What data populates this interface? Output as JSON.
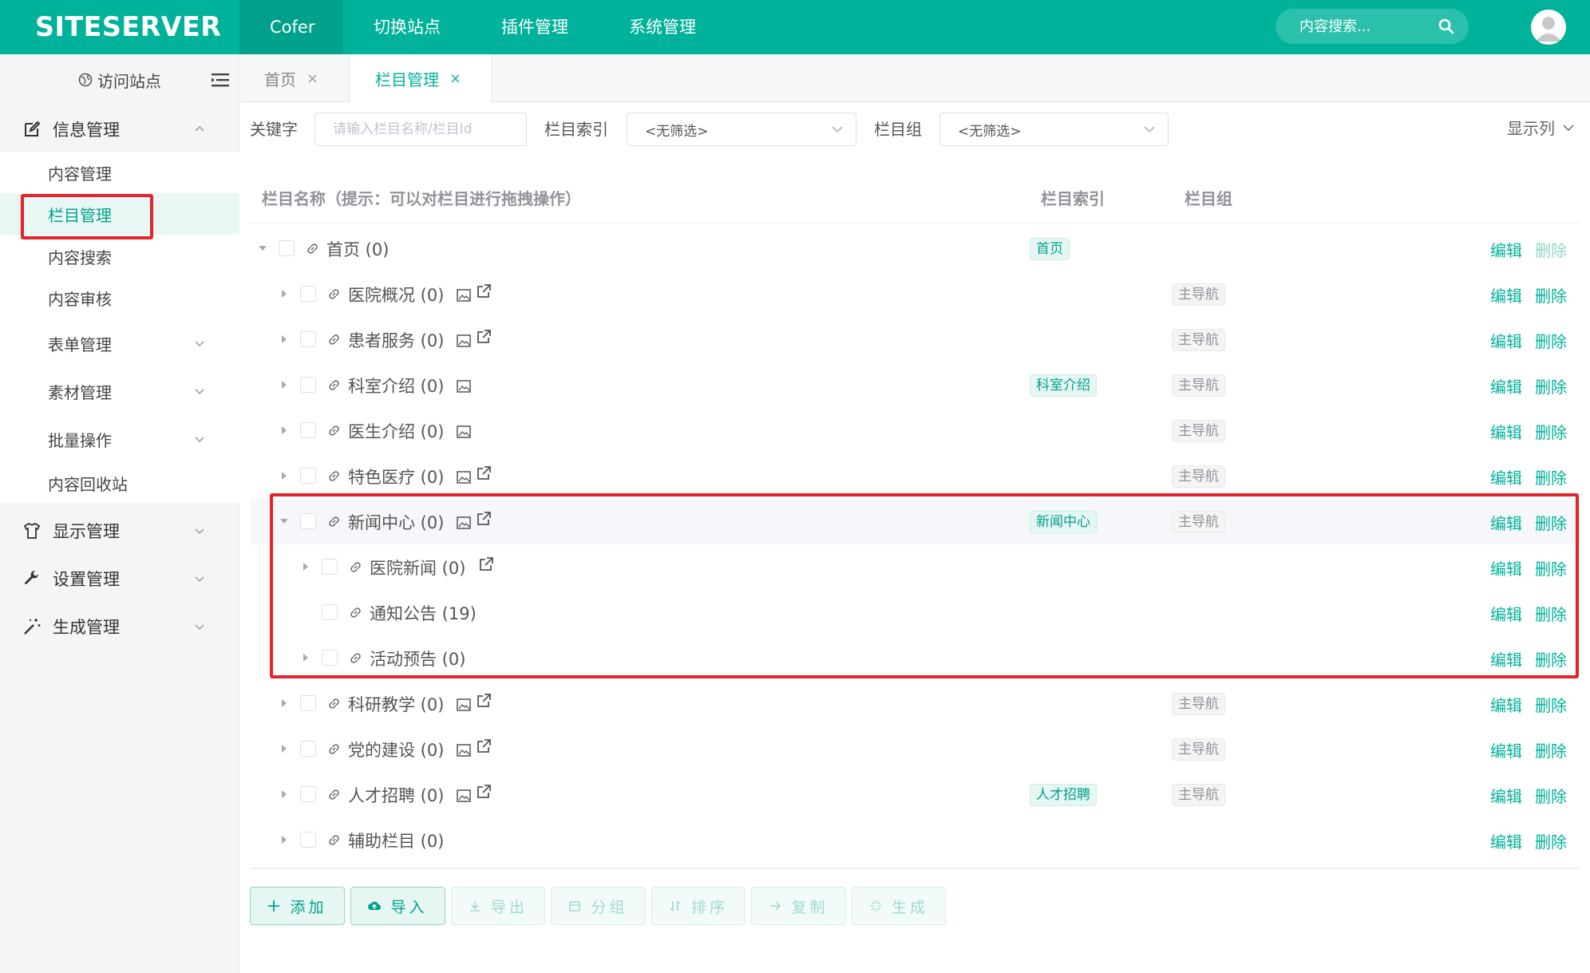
{
  "header": {
    "logo": "SITESERVER",
    "nav": [
      "Cofer",
      "切换站点",
      "插件管理",
      "系统管理"
    ],
    "search_placeholder": "内容搜索..."
  },
  "sidebar": {
    "visit_site": "访问站点",
    "groups": [
      {
        "label": "信息管理",
        "icon": "edit-icon",
        "expanded": true
      },
      {
        "label": "显示管理",
        "icon": "shirt-icon"
      },
      {
        "label": "设置管理",
        "icon": "wrench-icon"
      },
      {
        "label": "生成管理",
        "icon": "magic-wand-icon"
      }
    ],
    "sub_items": [
      "内容管理",
      "栏目管理",
      "内容搜索",
      "内容审核",
      "表单管理",
      "素材管理",
      "批量操作",
      "内容回收站"
    ],
    "active_sub": "栏目管理"
  },
  "tabs": [
    {
      "label": "首页"
    },
    {
      "label": "栏目管理",
      "active": true
    }
  ],
  "filters": {
    "keyword_label": "关键字",
    "keyword_placeholder": "请输入栏目名称/栏目Id",
    "index_label": "栏目索引",
    "index_value": "<无筛选>",
    "group_label": "栏目组",
    "group_value": "<无筛选>",
    "show_columns": "显示列"
  },
  "table": {
    "columns": {
      "name": "栏目名称（提示：可以对栏目进行拖拽操作）",
      "index": "栏目索引",
      "group": "栏目组"
    },
    "edit_label": "编辑",
    "delete_label": "删除",
    "rows": [
      {
        "name": "首页 (0)",
        "index": "首页",
        "group": ""
      },
      {
        "name": "医院概况 (0)",
        "index": "",
        "group": "主导航"
      },
      {
        "name": "患者服务 (0)",
        "index": "",
        "group": "主导航"
      },
      {
        "name": "科室介绍 (0)",
        "index": "科室介绍",
        "group": "主导航"
      },
      {
        "name": "医生介绍 (0)",
        "index": "",
        "group": "主导航"
      },
      {
        "name": "特色医疗 (0)",
        "index": "",
        "group": "主导航"
      },
      {
        "name": "新闻中心 (0)",
        "index": "新闻中心",
        "group": "主导航"
      },
      {
        "name": "医院新闻 (0)",
        "index": "",
        "group": ""
      },
      {
        "name": "通知公告 (19)",
        "index": "",
        "group": ""
      },
      {
        "name": "活动预告 (0)",
        "index": "",
        "group": ""
      },
      {
        "name": "科研教学 (0)",
        "index": "",
        "group": "主导航"
      },
      {
        "name": "党的建设 (0)",
        "index": "",
        "group": "主导航"
      },
      {
        "name": "人才招聘 (0)",
        "index": "人才招聘",
        "group": "主导航"
      },
      {
        "name": "辅助栏目 (0)",
        "index": "",
        "group": ""
      }
    ]
  },
  "actions": [
    "添加",
    "导入",
    "导出",
    "分组",
    "排序",
    "复制",
    "生成"
  ],
  "colors": {
    "primary": "#00b29a",
    "header_active": "#00a18b",
    "highlight_box": "#e5232a"
  }
}
